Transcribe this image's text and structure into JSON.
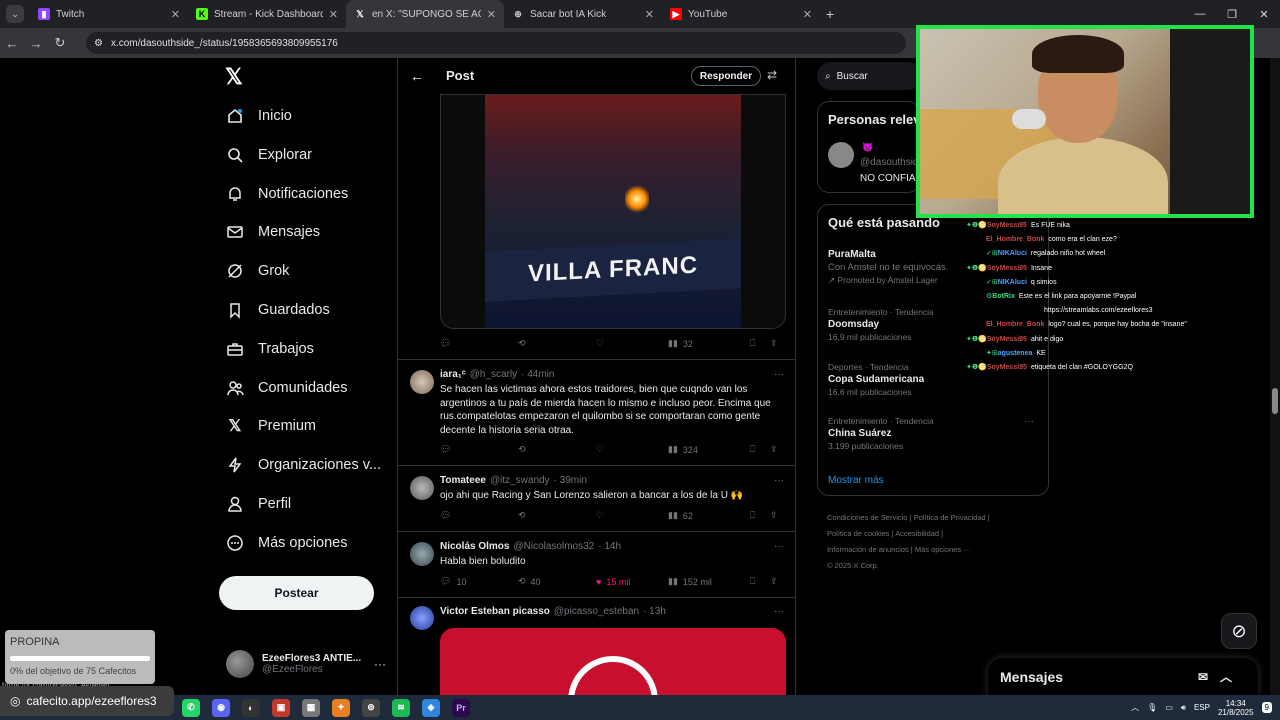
{
  "browser": {
    "tabs": [
      {
        "title": "Twitch",
        "icon": "twitch-icon",
        "color": "#9146ff"
      },
      {
        "title": "Stream - Kick Dashboard",
        "icon": "kick-icon",
        "color": "#53fc18"
      },
      {
        "title": "en X: \"SUPONGO SE ACABÓ",
        "icon": "x-icon",
        "color": "#ffffff"
      },
      {
        "title": "Sacar bot IA Kick",
        "icon": "globe-icon",
        "color": "#cccccc"
      },
      {
        "title": "YouTube",
        "icon": "youtube-icon",
        "color": "#ff0000"
      }
    ],
    "url": "x.com/dasouthside_/status/1958365693809955176"
  },
  "nav": {
    "items": [
      {
        "label": "Inicio",
        "icon": "home-icon"
      },
      {
        "label": "Explorar",
        "icon": "search-icon"
      },
      {
        "label": "Notificaciones",
        "icon": "bell-icon"
      },
      {
        "label": "Mensajes",
        "icon": "mail-icon"
      },
      {
        "label": "Grok",
        "icon": "grok-icon"
      },
      {
        "label": "Guardados",
        "icon": "bookmark-icon"
      },
      {
        "label": "Trabajos",
        "icon": "briefcase-icon"
      },
      {
        "label": "Comunidades",
        "icon": "people-icon"
      },
      {
        "label": "Premium",
        "icon": "x-icon"
      },
      {
        "label": "Organizaciones v...",
        "icon": "lightning-icon"
      },
      {
        "label": "Perfil",
        "icon": "person-icon"
      },
      {
        "label": "Más opciones",
        "icon": "more-circle-icon"
      }
    ],
    "post_button": "Postear",
    "account": {
      "name": "EzeeFlores3 ANTIE...",
      "handle": "@EzeeFlores"
    }
  },
  "main": {
    "title": "Post",
    "reply_button": "Responder",
    "media1": {
      "banner_text": "VILLA FRANC"
    },
    "first_actions": {
      "views": "32"
    },
    "tweets": [
      {
        "user": "iara₁ᶜ",
        "handle": "@h_scarly",
        "time": "· 44min",
        "text": "Se hacen las victimas ahora estos traidores, bien que cuqndo van los argentinos a tu país de mierda hacen lo mismo e incluso peor. Encima que rus.compatelotas empezaron el quilombo si se comportaran como gente decente la historia seria otraa.",
        "replies": "",
        "reposts": "",
        "likes": "",
        "views": "324"
      },
      {
        "user": "Tomateee",
        "handle": "@itz_swandy",
        "time": "· 39min",
        "text": "ojo ahi que Racing y San Lorenzo salieron a bancar a los de la U 🙌",
        "replies": "",
        "reposts": "",
        "likes": "",
        "views": "62"
      },
      {
        "user": "Nicolás Olmos",
        "handle": "@Nicolasolmos32",
        "time": "· 14h",
        "text": "Habla bien boludito",
        "replies": "10",
        "reposts": "40",
        "likes": "15 mil",
        "views": "152 mil"
      },
      {
        "user": "Victor Esteban picasso",
        "handle": "@picasso_esteban",
        "time": "· 13h",
        "text": "",
        "replies": "",
        "reposts": "",
        "likes": "",
        "views": ""
      }
    ]
  },
  "right": {
    "search_placeholder": "Buscar",
    "related": {
      "title": "Personas relevantes",
      "emoji": "😈",
      "handle": "@dasouthside",
      "bio": "NO CONFIAR"
    },
    "trends": {
      "title": "Qué está pasando",
      "items": [
        {
          "category": "",
          "name": "PuraMalta",
          "posts": "Con Amstel no te equivocás.",
          "promo": "Promoted by Amstel Lager"
        },
        {
          "category": "Entretenimiento · Tendencia",
          "name": "Doomsday",
          "posts": "16,9 mil publicaciones"
        },
        {
          "category": "Deportes · Tendencia",
          "name": "Copa Sudamericana",
          "posts": "16,6 mil publicaciones"
        },
        {
          "category": "Entretenimiento · Tendencia",
          "name": "China Suárez",
          "posts": "3.199 publicaciones"
        }
      ],
      "show_more": "Mostrar más"
    },
    "footer": {
      "line1": "Condiciones de Servicio  |  Política de Privacidad  |",
      "line2": "Política de cookies  |  Accesibilidad  |",
      "line3": "Información de anuncios  |  Más opciones ···",
      "line4": "© 2025 X Corp."
    }
  },
  "chat": [
    {
      "badges": "✦❶♋",
      "user": "SoyMessi95",
      "color": "#c84848",
      "msg": "Es FUE nika"
    },
    {
      "badges": "",
      "user": "El_Hombre_Bonk",
      "color": "#c84848",
      "msg": "como era el clan eze?"
    },
    {
      "badges": "✓⊞",
      "user": "NIKAluci",
      "color": "#4fa0ff",
      "msg": "regalado niño hot wheel"
    },
    {
      "badges": "✦❶♋",
      "user": "SoyMessi95",
      "color": "#c84848",
      "msg": "Insane"
    },
    {
      "badges": "✓⊞",
      "user": "NIKAluci",
      "color": "#4fa0ff",
      "msg": "q simios"
    },
    {
      "badges": "⚙",
      "user": "BotRix",
      "color": "#3ddc84",
      "msg": "Este es el link para apoyarme !Paypal"
    },
    {
      "badges": "",
      "user": "",
      "color": "#ffffff",
      "msg": "https://streamlabs.com/ezeeflores3"
    },
    {
      "badges": "",
      "user": "El_Hombre_Bonk",
      "color": "#c84848",
      "msg": "logo? cual es, porque hay bocha de \"insane\""
    },
    {
      "badges": "✦❶♋",
      "user": "SoyMessi95",
      "color": "#c84848",
      "msg": "ahit e digo"
    },
    {
      "badges": "✦⊞",
      "user": "agustenea",
      "color": "#4fa0ff",
      "msg": "KE"
    },
    {
      "badges": "✦❶♋",
      "user": "SoyMessi95",
      "color": "#c84848",
      "msg": "etiqueta del clan #GOLOYGG2Q"
    }
  ],
  "messages_bar": {
    "title": "Mensajes"
  },
  "overlay": {
    "propina_title": "PROPINA",
    "propina_progress": 0,
    "propina_goal": "0% del objetivo de 75 Cafecitos",
    "link": "cafecito.app/ezeeflores3",
    "status_url": "https://x.com/picasso_esteban"
  },
  "taskbar": {
    "lang": "ESP",
    "time": "14:34",
    "date": "21/8/2025",
    "notif": "9"
  }
}
